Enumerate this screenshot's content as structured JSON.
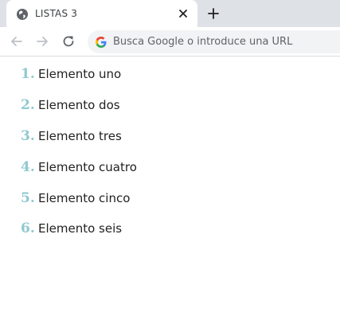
{
  "browser": {
    "tab": {
      "title": "LISTAS 3"
    },
    "omnibox": {
      "placeholder": "Busca Google o introduce una URL"
    }
  },
  "page": {
    "items": [
      {
        "number": "1.",
        "label": "Elemento uno"
      },
      {
        "number": "2.",
        "label": "Elemento dos"
      },
      {
        "number": "3.",
        "label": "Elemento tres"
      },
      {
        "number": "4.",
        "label": "Elemento cuatro"
      },
      {
        "number": "5.",
        "label": "Elemento cinco"
      },
      {
        "number": "6.",
        "label": "Elemento seis"
      }
    ]
  },
  "colors": {
    "tabbar": "#dee1e6",
    "number_accent": "#8fc9cf"
  }
}
